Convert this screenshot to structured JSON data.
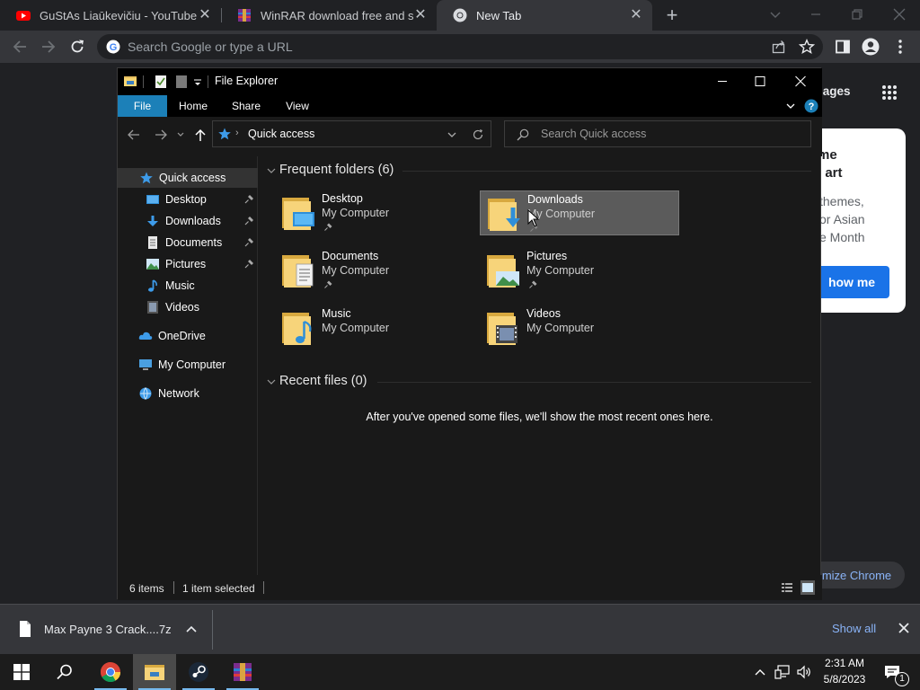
{
  "browser": {
    "tabs": [
      {
        "title": "GuStAs Liaūkevičiu - YouTube",
        "icon": "youtube-icon"
      },
      {
        "title": "WinRAR download free and supp",
        "icon": "winrar-icon"
      },
      {
        "title": "New Tab",
        "icon": "chrome-icon"
      }
    ],
    "omnibox_placeholder": "Search Google or type a URL",
    "ntp": {
      "images_link": "Images",
      "card_title_1": "me",
      "card_title_2": "l art",
      "card_desc_1": "themes,",
      "card_desc_2": "or Asian",
      "card_desc_3": "e Month",
      "show_me": "how me",
      "customize": "mize Chrome"
    },
    "accent": "#1a73e8"
  },
  "explorer": {
    "title": "File Explorer",
    "ribbon_tabs": [
      "File",
      "Home",
      "Share",
      "View"
    ],
    "address": "Quick access",
    "search_placeholder": "Search Quick access",
    "nav": [
      {
        "label": "Quick access",
        "icon": "star-icon"
      },
      {
        "label": "Desktop",
        "icon": "desktop-icon",
        "pinned": true
      },
      {
        "label": "Downloads",
        "icon": "download-icon",
        "pinned": true
      },
      {
        "label": "Documents",
        "icon": "document-icon",
        "pinned": true
      },
      {
        "label": "Pictures",
        "icon": "pictures-icon",
        "pinned": true
      },
      {
        "label": "Music",
        "icon": "music-icon"
      },
      {
        "label": "Videos",
        "icon": "videos-icon"
      },
      {
        "label": "OneDrive",
        "icon": "cloud-icon"
      },
      {
        "label": "My Computer",
        "icon": "computer-icon"
      },
      {
        "label": "Network",
        "icon": "network-icon"
      }
    ],
    "frequent_header": "Frequent folders (6)",
    "folders": [
      {
        "name": "Desktop",
        "location": "My Computer"
      },
      {
        "name": "Downloads",
        "location": "My Computer"
      },
      {
        "name": "Documents",
        "location": "My Computer"
      },
      {
        "name": "Pictures",
        "location": "My Computer"
      },
      {
        "name": "Music",
        "location": "My Computer"
      },
      {
        "name": "Videos",
        "location": "My Computer"
      }
    ],
    "recent_header": "Recent files (0)",
    "recent_empty": "After you've opened some files, we'll show the most recent ones here.",
    "status_items": "6 items",
    "status_selected": "1 item selected",
    "ribbon_accent": "#1c80b8"
  },
  "download_shelf": {
    "filename": "Max Payne 3 Crack....7z",
    "show_all": "Show all"
  },
  "taskbar": {
    "time": "2:31 AM",
    "date": "5/8/2023",
    "notification_count": "1"
  }
}
